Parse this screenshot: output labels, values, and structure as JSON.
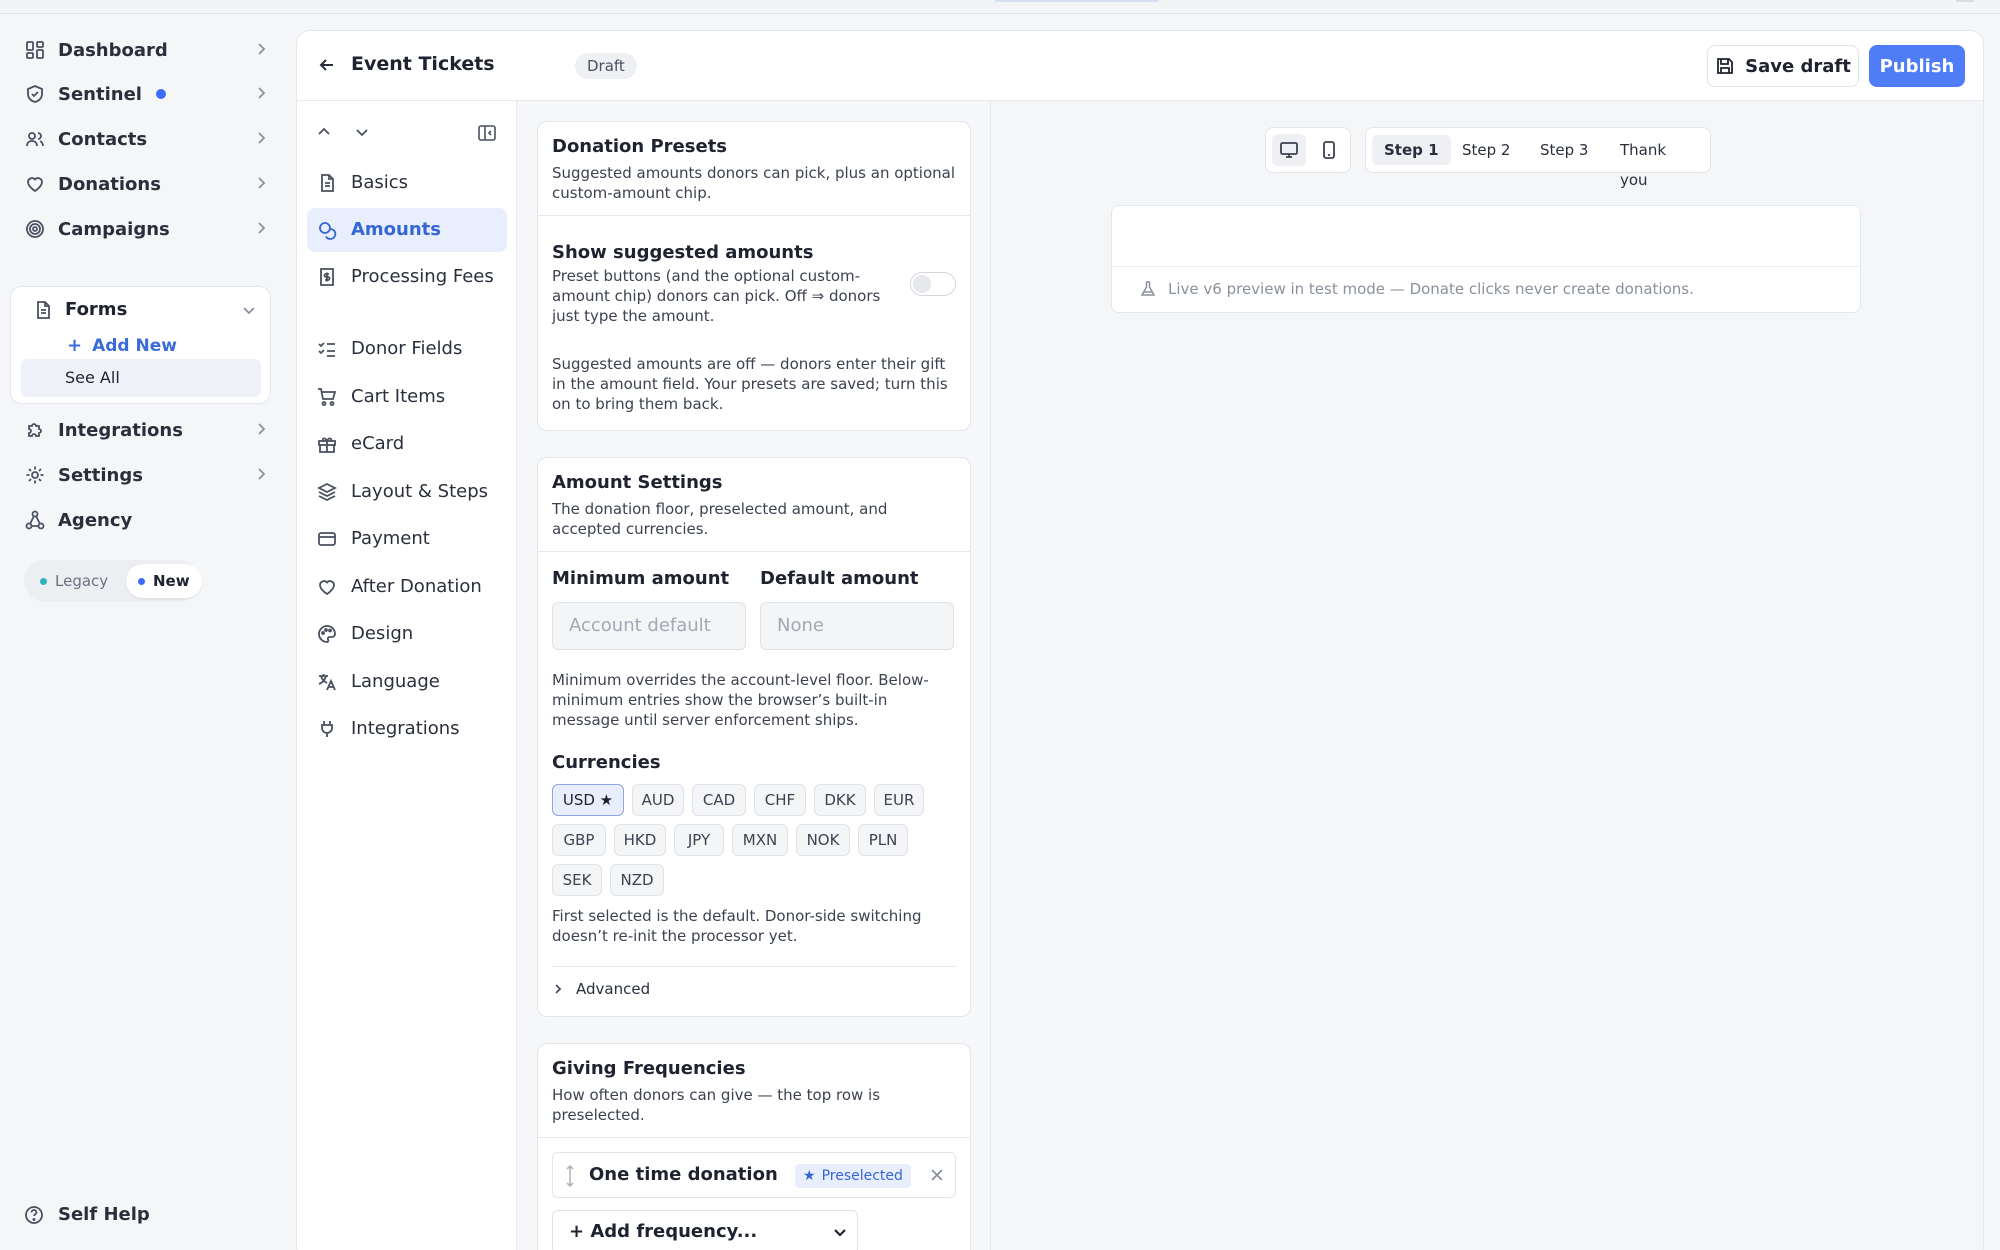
{
  "sidebar": {
    "items": [
      {
        "label": "Dashboard",
        "icon": "dashboard-icon"
      },
      {
        "label": "Sentinel",
        "icon": "shield-icon"
      },
      {
        "label": "Contacts",
        "icon": "users-icon"
      },
      {
        "label": "Donations",
        "icon": "heart-icon"
      },
      {
        "label": "Campaigns",
        "icon": "target-icon"
      }
    ],
    "forms": {
      "label": "Forms",
      "add_new": "Add New",
      "see_all": "See All"
    },
    "items_after": [
      {
        "label": "Integrations",
        "icon": "puzzle-icon"
      },
      {
        "label": "Settings",
        "icon": "gear-icon"
      },
      {
        "label": "Agency",
        "icon": "network-icon"
      }
    ],
    "version_toggle": {
      "legacy": "Legacy",
      "new": "New"
    },
    "self_help": "Self Help"
  },
  "header": {
    "title": "Event Tickets",
    "status": "Draft",
    "save_draft": "Save draft",
    "publish": "Publish"
  },
  "subnav": {
    "items": [
      {
        "label": "Basics",
        "icon": "file-icon"
      },
      {
        "label": "Amounts",
        "icon": "coins-icon",
        "active": true
      },
      {
        "label": "Processing Fees",
        "icon": "receipt-dollar-icon"
      },
      {
        "label": "Donor Fields",
        "icon": "checklist-icon"
      },
      {
        "label": "Cart Items",
        "icon": "cart-icon"
      },
      {
        "label": "eCard",
        "icon": "gift-icon"
      },
      {
        "label": "Layout & Steps",
        "icon": "layers-icon"
      },
      {
        "label": "Payment",
        "icon": "credit-card-icon"
      },
      {
        "label": "After Donation",
        "icon": "heart-icon"
      },
      {
        "label": "Design",
        "icon": "palette-icon"
      },
      {
        "label": "Language",
        "icon": "translate-icon"
      },
      {
        "label": "Integrations",
        "icon": "plug-icon"
      }
    ]
  },
  "presets": {
    "title": "Donation Presets",
    "desc": "Suggested amounts donors can pick, plus an optional custom-amount chip.",
    "show_label": "Show suggested amounts",
    "show_desc": "Preset buttons (and the optional custom-amount chip) donors can pick. Off ⇒ donors just type the amount.",
    "off_note": "Suggested amounts are off — donors enter their gift in the amount field. Your presets are saved; turn this on to bring them back."
  },
  "amount_settings": {
    "title": "Amount Settings",
    "desc": "The donation floor, preselected amount, and accepted currencies.",
    "min_label": "Minimum amount",
    "min_placeholder": "Account default",
    "default_label": "Default amount",
    "default_placeholder": "None",
    "min_note": "Minimum overrides the account-level floor. Below-minimum entries show the browser’s built-in message until server enforcement ships.",
    "currencies_label": "Currencies",
    "currencies": [
      "USD ★",
      "AUD",
      "CAD",
      "CHF",
      "DKK",
      "EUR",
      "GBP",
      "HKD",
      "JPY",
      "MXN",
      "NOK",
      "PLN",
      "SEK",
      "NZD"
    ],
    "currency_note": "First selected is the default. Donor-side switching doesn’t re-init the processor yet.",
    "advanced": "Advanced"
  },
  "frequencies": {
    "title": "Giving Frequencies",
    "desc": "How often donors can give — the top row is preselected.",
    "row_label": "One time donation",
    "row_badge": "Preselected",
    "add_label": "+ Add frequency..."
  },
  "preview": {
    "steps": [
      "Step 1",
      "Step 2",
      "Step 3",
      "Thank you"
    ],
    "note": "Live v6 preview in test mode — Donate clicks never create donations."
  },
  "colors": {
    "accent": "#4f7cf7",
    "active_bg": "#e8eefb"
  }
}
